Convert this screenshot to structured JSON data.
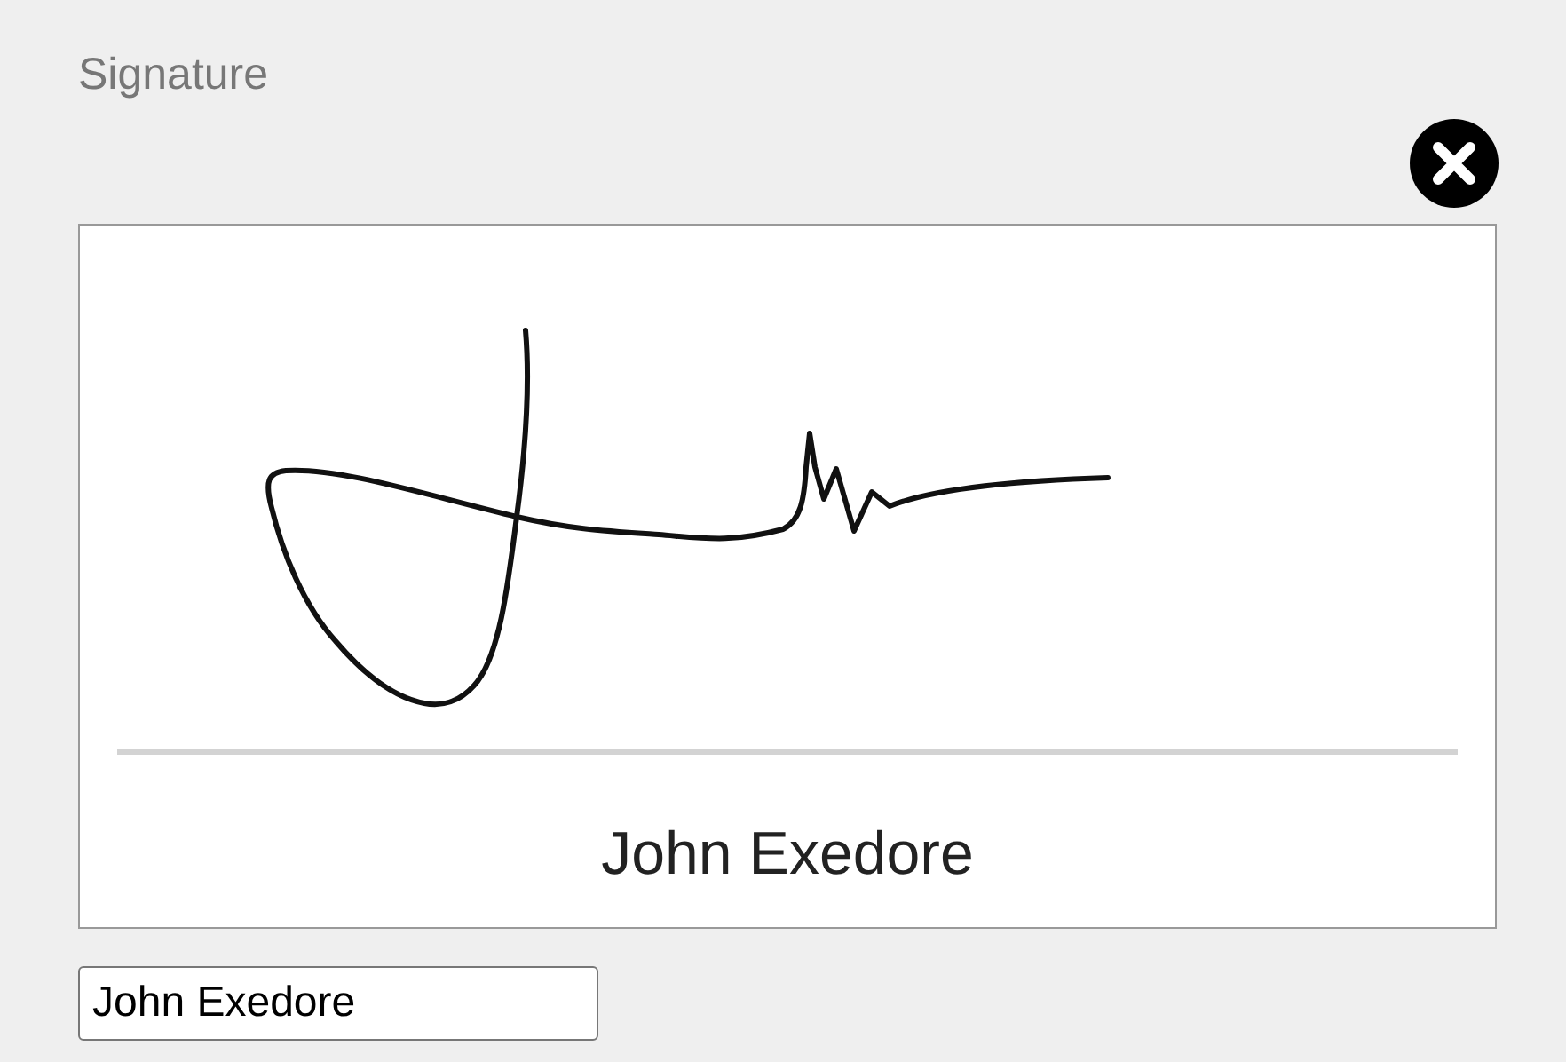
{
  "title": "Signature",
  "signature_pad": {
    "printed_name": "John Exedore"
  },
  "name_field": {
    "value": "John Exedore"
  }
}
